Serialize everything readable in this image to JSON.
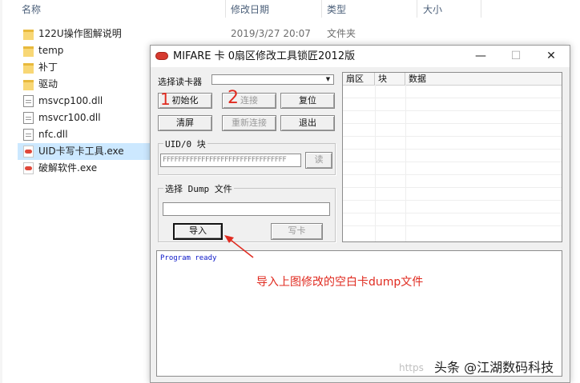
{
  "explorer": {
    "columns": [
      "名称",
      "修改日期",
      "类型",
      "大小"
    ],
    "files": [
      {
        "name": "122U操作图解说明",
        "date": "2019/3/27 20:07",
        "type": "文件夹",
        "icon": "folder-icon"
      },
      {
        "name": "temp",
        "date": "",
        "type": "",
        "icon": "folder-icon"
      },
      {
        "name": "补丁",
        "date": "",
        "type": "",
        "icon": "folder-icon"
      },
      {
        "name": "驱动",
        "date": "",
        "type": "",
        "icon": "folder-icon"
      },
      {
        "name": "msvcp100.dll",
        "date": "",
        "type": "",
        "icon": "dll-file-icon"
      },
      {
        "name": "msvcr100.dll",
        "date": "",
        "type": "",
        "icon": "dll-file-icon"
      },
      {
        "name": "nfc.dll",
        "date": "",
        "type": "",
        "icon": "dll-file-icon"
      },
      {
        "name": "UID卡写卡工具.exe",
        "date": "",
        "type": "",
        "icon": "exe-file-icon",
        "selected": true
      },
      {
        "name": "破解软件.exe",
        "date": "",
        "type": "",
        "icon": "exe-file-icon"
      }
    ]
  },
  "dialog": {
    "title": "MIFARE 卡 0扇区修改工具锁匠2012版",
    "controls": {
      "minimize": "—",
      "maximize": "☐",
      "close": "✕"
    },
    "reader_label": "选择读卡器",
    "reader_value": "",
    "buttons": {
      "init": "初始化",
      "connect": "连接",
      "reset": "复位",
      "clear": "清屏",
      "reconnect": "重新连接",
      "exit": "退出",
      "read": "读",
      "import": "导入",
      "write": "写卡"
    },
    "uid_group_title": "UID/0 块",
    "uid_value": "FFFFFFFFFFFFFFFFFFFFFFFFFFFFFFFF",
    "dump_group_title": "选择 Dump 文件",
    "dump_path": "",
    "list_columns": [
      "扇区",
      "块",
      "数据"
    ],
    "log_text": "Program ready"
  },
  "annotations": {
    "mark_1": "1",
    "mark_2": "2",
    "note": "导入上图修改的空白卡dump文件",
    "color": "#e02b20"
  },
  "watermark": {
    "faint": "https",
    "text": "头条 @江湖数码科技"
  }
}
